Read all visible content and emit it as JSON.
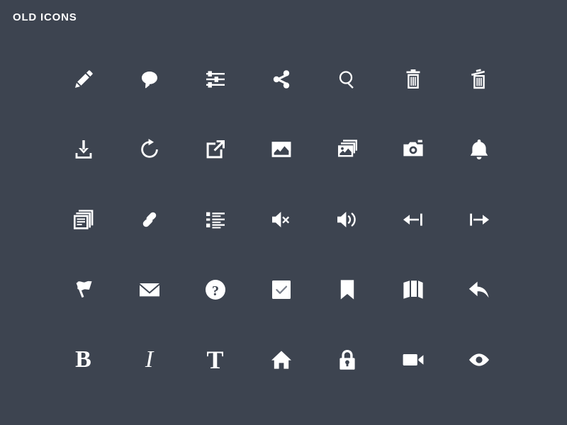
{
  "page": {
    "title": "OLD ICONS",
    "background_color": "#3d4450",
    "icon_color": "#ffffff",
    "columns": 7,
    "rows": 5,
    "icon_count": 35
  },
  "icons": [
    {
      "name": "pencil-icon",
      "label": "Pencil"
    },
    {
      "name": "comment-icon",
      "label": "Comment"
    },
    {
      "name": "sliders-icon",
      "label": "Sliders"
    },
    {
      "name": "share-icon",
      "label": "Share"
    },
    {
      "name": "search-icon",
      "label": "Search"
    },
    {
      "name": "trash-icon",
      "label": "Trash"
    },
    {
      "name": "trash-open-icon",
      "label": "Trash Open"
    },
    {
      "name": "download-icon",
      "label": "Download"
    },
    {
      "name": "refresh-icon",
      "label": "Refresh"
    },
    {
      "name": "external-link-icon",
      "label": "External Link"
    },
    {
      "name": "image-icon",
      "label": "Image"
    },
    {
      "name": "images-icon",
      "label": "Images"
    },
    {
      "name": "camera-icon",
      "label": "Camera"
    },
    {
      "name": "bell-icon",
      "label": "Bell"
    },
    {
      "name": "documents-icon",
      "label": "Documents"
    },
    {
      "name": "link-icon",
      "label": "Link"
    },
    {
      "name": "list-icon",
      "label": "List"
    },
    {
      "name": "volume-mute-icon",
      "label": "Volume Mute"
    },
    {
      "name": "volume-up-icon",
      "label": "Volume Up"
    },
    {
      "name": "arrow-to-left-icon",
      "label": "Arrow To Left"
    },
    {
      "name": "arrow-to-right-icon",
      "label": "Arrow To Right"
    },
    {
      "name": "flag-icon",
      "label": "Flag"
    },
    {
      "name": "envelope-icon",
      "label": "Envelope"
    },
    {
      "name": "help-circle-icon",
      "label": "Help"
    },
    {
      "name": "checkbox-checked-icon",
      "label": "Checkbox Checked"
    },
    {
      "name": "bookmark-icon",
      "label": "Bookmark"
    },
    {
      "name": "map-icon",
      "label": "Map"
    },
    {
      "name": "reply-icon",
      "label": "Reply"
    },
    {
      "name": "bold-icon",
      "label": "Bold",
      "glyph": "B"
    },
    {
      "name": "italic-icon",
      "label": "Italic",
      "glyph": "I"
    },
    {
      "name": "typography-icon",
      "label": "Typography",
      "glyph": "T"
    },
    {
      "name": "home-icon",
      "label": "Home"
    },
    {
      "name": "lock-icon",
      "label": "Lock"
    },
    {
      "name": "video-camera-icon",
      "label": "Video Camera"
    },
    {
      "name": "eye-icon",
      "label": "Eye"
    }
  ]
}
